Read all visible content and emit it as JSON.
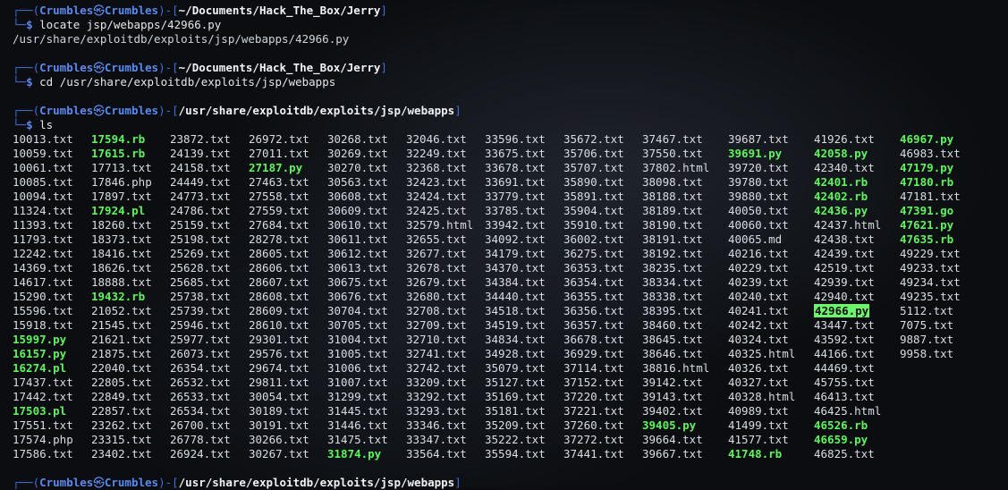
{
  "prompt": {
    "user": "Crumbles",
    "host": "Crumbles",
    "at": "㋱"
  },
  "blocks": [
    {
      "path": "~/Documents/Hack_The_Box/Jerry",
      "command": "locate jsp/webapps/42966.py",
      "output": "/usr/share/exploitdb/exploits/jsp/webapps/42966.py"
    },
    {
      "path": "~/Documents/Hack_The_Box/Jerry",
      "command": "cd /usr/share/exploitdb/exploits/jsp/webapps"
    },
    {
      "path": "/usr/share/exploitdb/exploits/jsp/webapps",
      "command": "ls"
    }
  ],
  "final_prompt_path": "/usr/share/exploitdb/exploits/jsp/webapps",
  "colors": {
    "executable": "#5cf55c",
    "highlight_bg": "#6cf46c",
    "prompt_blue": "#5a8af0"
  },
  "files": [
    [
      "10013.txt",
      "10059.txt",
      "10061.txt",
      "10085.txt",
      "10094.txt",
      "11324.txt",
      "11393.txt",
      "11793.txt",
      "12242.txt",
      "14369.txt",
      "14617.txt",
      "15290.txt",
      "15596.txt",
      "15918.txt",
      "15997.py",
      "16157.py",
      "16274.pl",
      "17437.txt",
      "17442.txt",
      "17503.pl",
      "17551.txt",
      "17574.php",
      "17586.txt"
    ],
    [
      "17594.rb",
      "17615.rb",
      "17713.txt",
      "17846.php",
      "17897.txt",
      "17924.pl",
      "18260.txt",
      "18373.txt",
      "18416.txt",
      "18626.txt",
      "18888.txt",
      "19432.rb",
      "21052.txt",
      "21545.txt",
      "21621.txt",
      "21875.txt",
      "22040.txt",
      "22805.txt",
      "22849.txt",
      "22857.txt",
      "23262.txt",
      "23315.txt",
      "23402.txt"
    ],
    [
      "23872.txt",
      "24139.txt",
      "24158.txt",
      "24449.txt",
      "24773.txt",
      "24786.txt",
      "25159.txt",
      "25198.txt",
      "25269.txt",
      "25628.txt",
      "25685.txt",
      "25738.txt",
      "25739.txt",
      "25946.txt",
      "25977.txt",
      "26073.txt",
      "26354.txt",
      "26532.txt",
      "26533.txt",
      "26534.txt",
      "26700.txt",
      "26778.txt",
      "26924.txt"
    ],
    [
      "26972.txt",
      "27011.txt",
      "27187.py",
      "27463.txt",
      "27558.txt",
      "27559.txt",
      "27684.txt",
      "28278.txt",
      "28605.txt",
      "28606.txt",
      "28607.txt",
      "28608.txt",
      "28609.txt",
      "28610.txt",
      "29301.txt",
      "29576.txt",
      "29674.txt",
      "29811.txt",
      "30054.txt",
      "30189.txt",
      "30191.txt",
      "30266.txt",
      "30267.txt"
    ],
    [
      "30268.txt",
      "30269.txt",
      "30270.txt",
      "30563.txt",
      "30608.txt",
      "30609.txt",
      "30610.txt",
      "30611.txt",
      "30612.txt",
      "30613.txt",
      "30675.txt",
      "30676.txt",
      "30704.txt",
      "30705.txt",
      "31004.txt",
      "31005.txt",
      "31006.txt",
      "31007.txt",
      "31299.txt",
      "31445.txt",
      "31446.txt",
      "31475.txt",
      "31874.py"
    ],
    [
      "32046.txt",
      "32249.txt",
      "32368.txt",
      "32423.txt",
      "32424.txt",
      "32425.txt",
      "32579.html",
      "32655.txt",
      "32677.txt",
      "32678.txt",
      "32679.txt",
      "32680.txt",
      "32708.txt",
      "32709.txt",
      "32710.txt",
      "32741.txt",
      "32742.txt",
      "33209.txt",
      "33292.txt",
      "33293.txt",
      "33346.txt",
      "33347.txt",
      "33564.txt"
    ],
    [
      "33596.txt",
      "33675.txt",
      "33678.txt",
      "33691.txt",
      "33779.txt",
      "33785.txt",
      "33942.txt",
      "34092.txt",
      "34179.txt",
      "34370.txt",
      "34384.txt",
      "34440.txt",
      "34518.txt",
      "34519.txt",
      "34834.txt",
      "34928.txt",
      "35079.txt",
      "35127.txt",
      "35169.txt",
      "35181.txt",
      "35209.txt",
      "35222.txt",
      "35594.txt"
    ],
    [
      "35672.txt",
      "35706.txt",
      "35707.txt",
      "35890.txt",
      "35891.txt",
      "35904.txt",
      "35910.txt",
      "36002.txt",
      "36275.txt",
      "36353.txt",
      "36354.txt",
      "36355.txt",
      "36356.txt",
      "36357.txt",
      "36678.txt",
      "36929.txt",
      "37114.txt",
      "37152.txt",
      "37220.txt",
      "37221.txt",
      "37260.txt",
      "37272.txt",
      "37441.txt"
    ],
    [
      "37467.txt",
      "37550.txt",
      "37802.html",
      "38098.txt",
      "38188.txt",
      "38189.txt",
      "38190.txt",
      "38191.txt",
      "38192.txt",
      "38235.txt",
      "38334.txt",
      "38338.txt",
      "38395.txt",
      "38460.txt",
      "38645.txt",
      "38646.txt",
      "38816.html",
      "39142.txt",
      "39143.txt",
      "39402.txt",
      "39405.py",
      "39664.txt",
      "39667.txt"
    ],
    [
      "39687.txt",
      "39691.py",
      "39720.txt",
      "39780.txt",
      "39880.txt",
      "40050.txt",
      "40060.txt",
      "40065.md",
      "40216.txt",
      "40229.txt",
      "40239.txt",
      "40240.txt",
      "40241.txt",
      "40242.txt",
      "40324.txt",
      "40325.html",
      "40326.txt",
      "40327.txt",
      "40328.html",
      "40989.txt",
      "41499.txt",
      "41577.txt",
      "41748.rb"
    ],
    [
      "41926.txt",
      "42058.py",
      "42340.txt",
      "42401.rb",
      "42402.rb",
      "42436.py",
      "42437.html",
      "42438.txt",
      "42439.txt",
      "42519.txt",
      "42939.txt",
      "42940.txt",
      "42966.py",
      "43447.txt",
      "43592.txt",
      "44166.txt",
      "44469.txt",
      "45755.txt",
      "46413.txt",
      "46425.html",
      "46526.rb",
      "46659.py",
      "46825.txt"
    ],
    [
      "46967.py",
      "46983.txt",
      "47179.py",
      "47180.rb",
      "47181.txt",
      "47391.go",
      "47621.py",
      "47635.rb",
      "49229.txt",
      "49233.txt",
      "49234.txt",
      "49235.txt",
      "5112.txt",
      "7075.txt",
      "9887.txt",
      "9958.txt"
    ]
  ],
  "highlighted_file": "42966.py"
}
